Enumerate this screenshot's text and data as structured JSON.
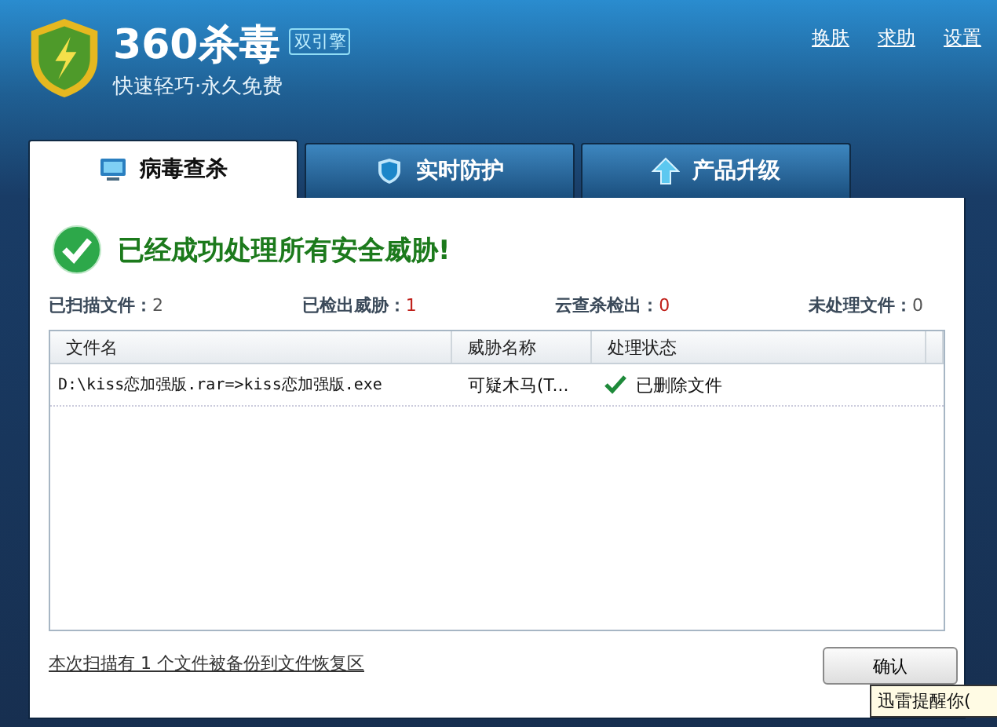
{
  "brand": {
    "name": "360杀毒",
    "badge": "双引擎",
    "slogan": "快速轻巧·永久免费"
  },
  "top_links": [
    "换肤",
    "求助",
    "设置"
  ],
  "tabs": [
    {
      "label": "病毒查杀",
      "kind": "scan",
      "selected": true
    },
    {
      "label": "实时防护",
      "kind": "protect",
      "selected": false
    },
    {
      "label": "产品升级",
      "kind": "upgrade",
      "selected": false
    }
  ],
  "result": "已经成功处理所有安全威胁!",
  "stats": [
    {
      "label": "已扫描文件：",
      "value": "2",
      "alert": false
    },
    {
      "label": "已检出威胁：",
      "value": "1",
      "alert": true
    },
    {
      "label": "云查杀检出：",
      "value": "0",
      "alert": true
    },
    {
      "label": "未处理文件：",
      "value": "0",
      "alert": false
    }
  ],
  "table": {
    "columns": [
      "文件名",
      "威胁名称",
      "处理状态"
    ],
    "rows": [
      {
        "file": "D:\\kiss恋加强版.rar=>kiss恋加强版.exe",
        "threat": "可疑木马(T...",
        "status": "已删除文件",
        "done": true
      }
    ]
  },
  "backup_link": "本次扫描有 1 个文件被备份到文件恢复区",
  "confirm_button": "确认",
  "tooltip": "迅雷提醒你("
}
